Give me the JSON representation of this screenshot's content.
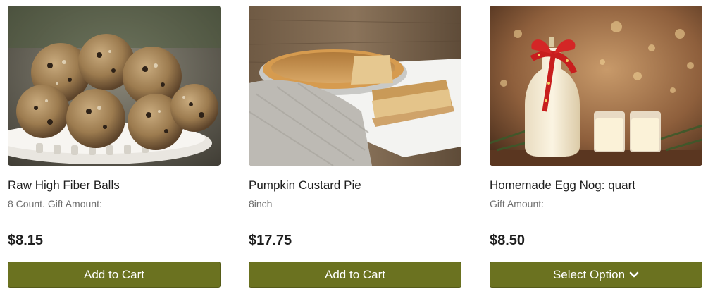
{
  "products": [
    {
      "name": "Raw High Fiber Balls",
      "subtitle": "8 Count. Gift Amount:",
      "price": "$8.15",
      "button_label": "Add to Cart",
      "image_icon": "fiber-balls-photo"
    },
    {
      "name": "Pumpkin Custard Pie",
      "subtitle": "8inch",
      "price": "$17.75",
      "button_label": "Add to Cart",
      "image_icon": "pumpkin-pie-photo"
    },
    {
      "name": "Homemade Egg Nog: quart",
      "subtitle": "Gift Amount:",
      "price": "$8.50",
      "button_label": "Select Option",
      "button_icon": "chevron-down-icon",
      "image_icon": "egg-nog-photo"
    }
  ],
  "colors": {
    "button_bg": "#6b7220",
    "button_text": "#ffffff",
    "title_text": "#1e1e1e",
    "subtitle_text": "#6e6e6e"
  }
}
